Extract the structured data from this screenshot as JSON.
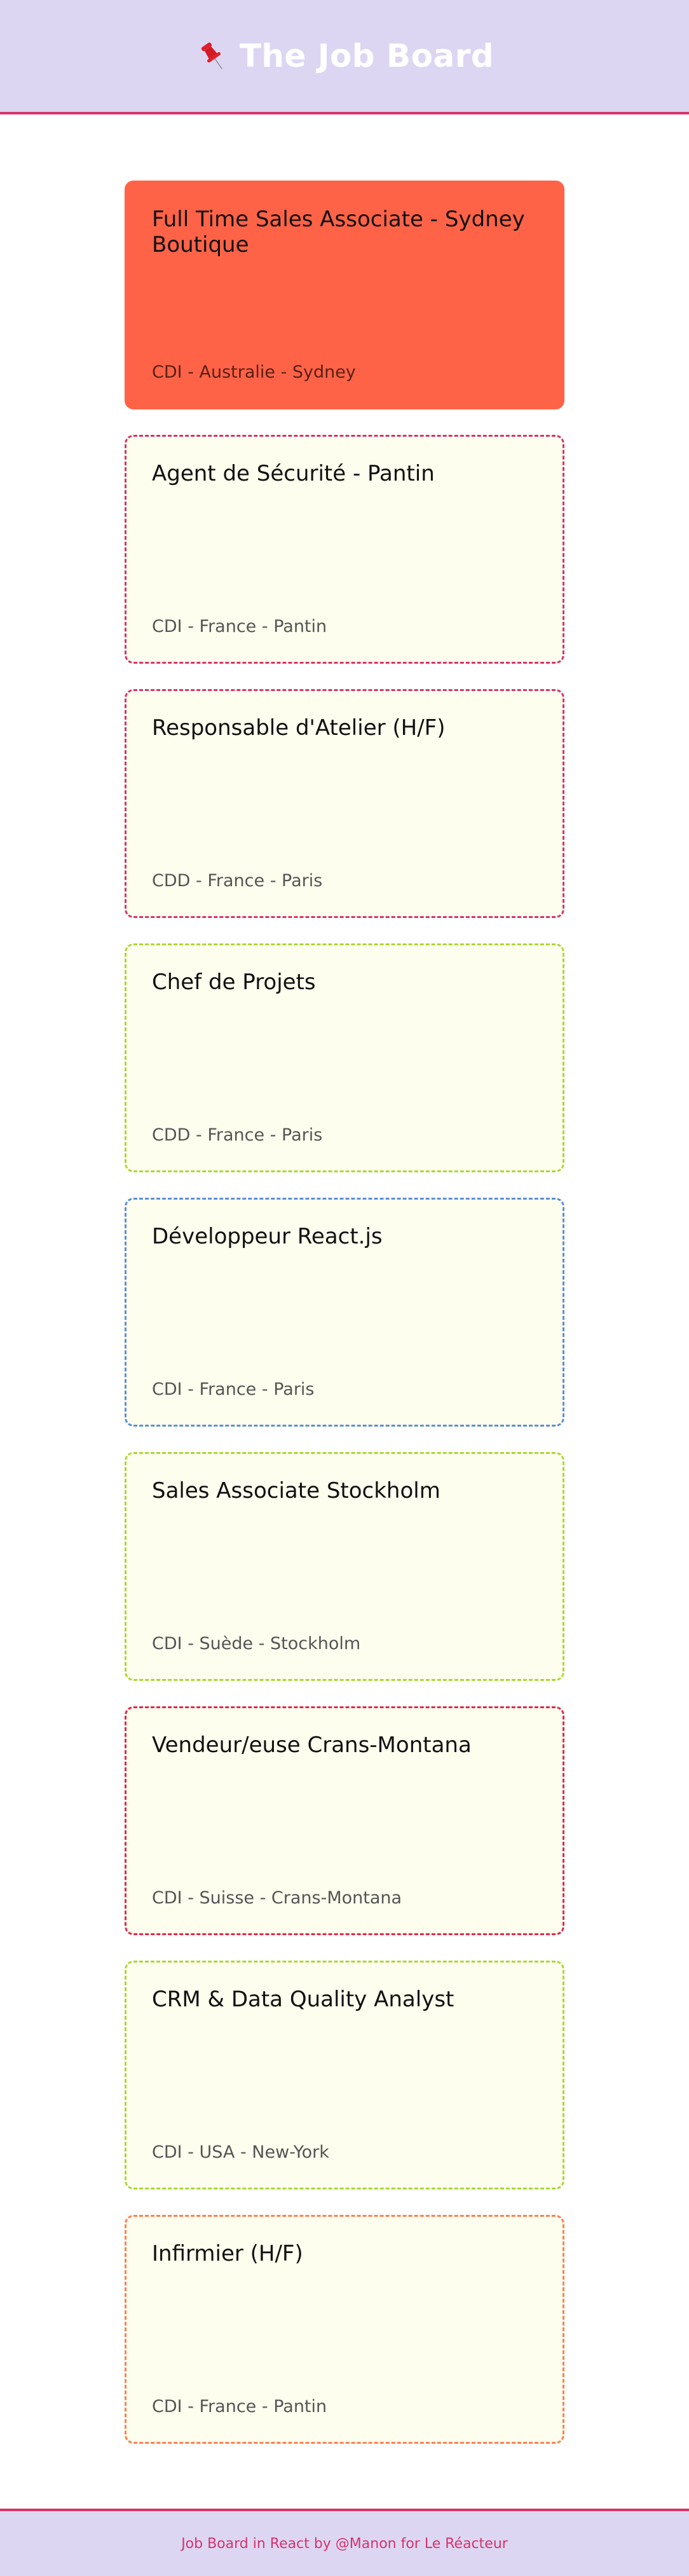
{
  "header": {
    "title": "The Job Board",
    "icon": "pushpin-icon",
    "background": "#dcd6f3",
    "accent": "#d6336c"
  },
  "jobs": [
    {
      "title": "Full Time Sales Associate - Sydney Boutique",
      "meta": "CDI - Australie - Sydney",
      "border_color": "#ff6347",
      "active": true
    },
    {
      "title": "Agent de Sécurité - Pantin",
      "meta": "CDI - France - Pantin",
      "border_color": "#d6336c",
      "active": false
    },
    {
      "title": "Responsable d'Atelier (H/F)",
      "meta": "CDD - France - Paris",
      "border_color": "#d6336c",
      "active": false
    },
    {
      "title": "Chef de Projets",
      "meta": "CDD - France - Paris",
      "border_color": "#a9d834",
      "active": false
    },
    {
      "title": "Développeur React.js",
      "meta": "CDI - France - Paris",
      "border_color": "#5b8ed6",
      "active": false
    },
    {
      "title": "Sales Associate Stockholm",
      "meta": "CDI - Suède - Stockholm",
      "border_color": "#a9d834",
      "active": false
    },
    {
      "title": "Vendeur/euse Crans-Montana",
      "meta": "CDI - Suisse - Crans-Montana",
      "border_color": "#e0284c",
      "active": false
    },
    {
      "title": "CRM & Data Quality Analyst",
      "meta": "CDI - USA - New-York",
      "border_color": "#a9d834",
      "active": false
    },
    {
      "title": "Infirmier (H/F)",
      "meta": "CDI - France - Pantin",
      "border_color": "#ff7f50",
      "active": false
    }
  ],
  "footer": {
    "text": "Job Board in React by @Manon for Le Réacteur"
  }
}
